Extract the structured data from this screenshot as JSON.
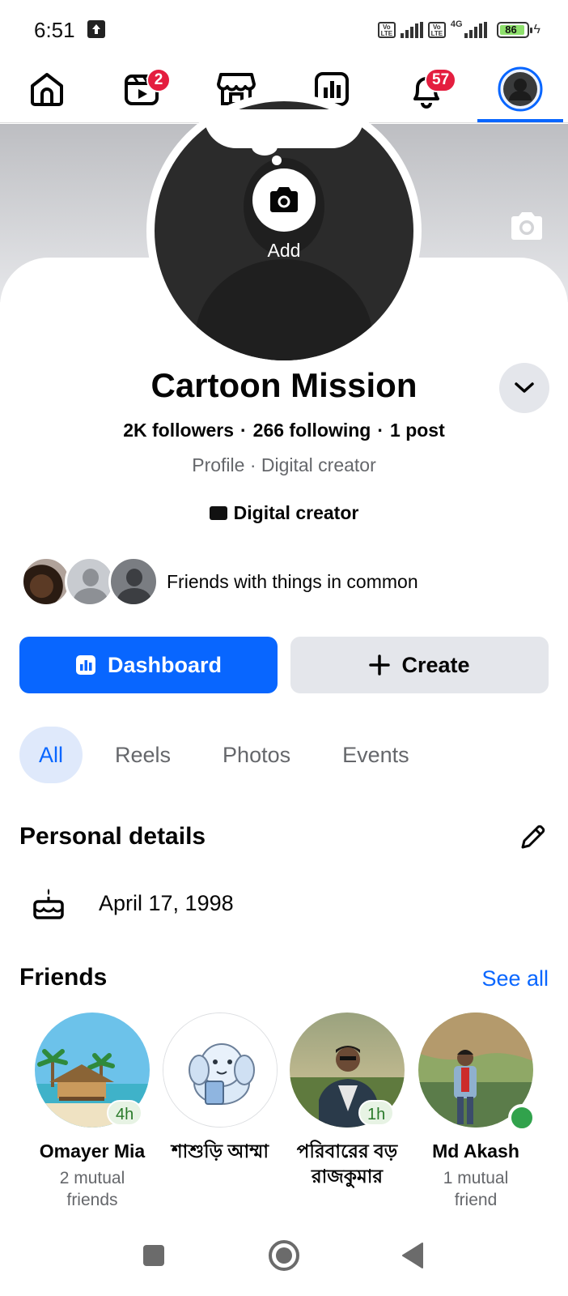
{
  "status_bar": {
    "time": "6:51",
    "network_type": "4G",
    "battery_level": "86",
    "volte_label": "Vo LTE"
  },
  "top_nav": {
    "items": [
      {
        "icon": "home-icon"
      },
      {
        "icon": "video-icon",
        "badge": "2"
      },
      {
        "icon": "marketplace-icon"
      },
      {
        "icon": "dashboard-icon"
      },
      {
        "icon": "bell-icon",
        "badge": "57"
      },
      {
        "icon": "profile-icon",
        "active": true
      }
    ],
    "active_color": "#0866ff",
    "badge_color": "#e41e3f"
  },
  "profile": {
    "add_photo_label": "Add",
    "name": "Cartoon Mission",
    "followers": "2K followers",
    "following": "266 following",
    "posts": "1 post",
    "stats_separator": "·",
    "subtitle": "Profile · Digital creator",
    "category": "Digital creator",
    "mutual_text": "Friends with things in common"
  },
  "actions": {
    "dashboard_label": "Dashboard",
    "create_label": "Create",
    "primary_color": "#0866ff"
  },
  "tabs": [
    {
      "label": "All",
      "active": true
    },
    {
      "label": "Reels"
    },
    {
      "label": "Photos"
    },
    {
      "label": "Events"
    }
  ],
  "personal_details": {
    "title": "Personal details",
    "birthday": "April 17, 1998"
  },
  "friends": {
    "title": "Friends",
    "see_all": "See all",
    "list": [
      {
        "name": "Omayer Mia",
        "mutual_line1": "2 mutual",
        "mutual_line2": "friends",
        "time": "4h"
      },
      {
        "name": "শাশুড়ি আম্মা",
        "mutual_line1": "",
        "mutual_line2": ""
      },
      {
        "name": "পরিবারের বড়",
        "name_line2": "রাজকুমার",
        "time": "1h"
      },
      {
        "name": "Md Akash",
        "mutual_line1": "1 mutual",
        "mutual_line2": "friend",
        "online": true
      }
    ]
  }
}
